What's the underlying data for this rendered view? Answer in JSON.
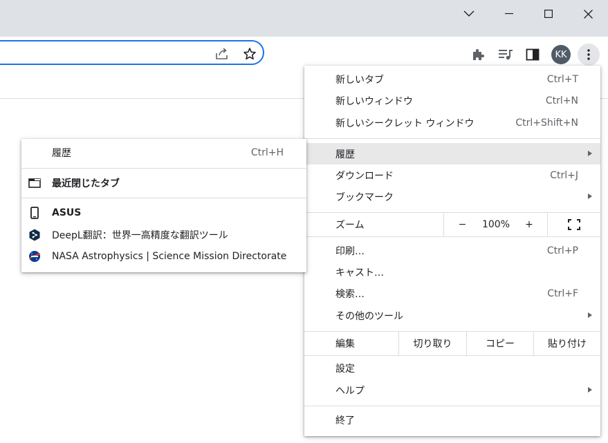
{
  "window": {
    "controls": [
      "chevron-down",
      "minimize",
      "maximize",
      "close"
    ]
  },
  "toolbar": {
    "avatar_initials": "KK"
  },
  "main_menu": {
    "new_tab": {
      "label": "新しいタブ",
      "shortcut": "Ctrl+T"
    },
    "new_window": {
      "label": "新しいウィンドウ",
      "shortcut": "Ctrl+N"
    },
    "new_incognito": {
      "label": "新しいシークレット ウィンドウ",
      "shortcut": "Ctrl+Shift+N"
    },
    "history": {
      "label": "履歴"
    },
    "downloads": {
      "label": "ダウンロード",
      "shortcut": "Ctrl+J"
    },
    "bookmarks": {
      "label": "ブックマーク"
    },
    "zoom": {
      "label": "ズーム",
      "minus": "−",
      "value": "100%",
      "plus": "+"
    },
    "print": {
      "label": "印刷…",
      "shortcut": "Ctrl+P"
    },
    "cast": {
      "label": "キャスト…"
    },
    "find": {
      "label": "検索…",
      "shortcut": "Ctrl+F"
    },
    "more_tools": {
      "label": "その他のツール"
    },
    "edit": {
      "label": "編集",
      "cut": "切り取り",
      "copy": "コピー",
      "paste": "貼り付け"
    },
    "settings": {
      "label": "設定"
    },
    "help": {
      "label": "ヘルプ"
    },
    "exit": {
      "label": "終了"
    }
  },
  "history_submenu": {
    "history": {
      "label": "履歴",
      "shortcut": "Ctrl+H"
    },
    "recently_closed": {
      "label": "最近閉じたタブ"
    },
    "device": {
      "label": "ASUS"
    },
    "items": [
      {
        "label": "DeepL翻訳：世界一高精度な翻訳ツール",
        "icon": "deepl-icon"
      },
      {
        "label": "NASA Astrophysics | Science Mission Directorate",
        "icon": "nasa-icon"
      }
    ]
  },
  "colors": {
    "omnibox_border": "#1a73e8",
    "titlebar": "#dee1e6",
    "highlight": "#e8e8e9",
    "avatar": "#4f5b66"
  }
}
